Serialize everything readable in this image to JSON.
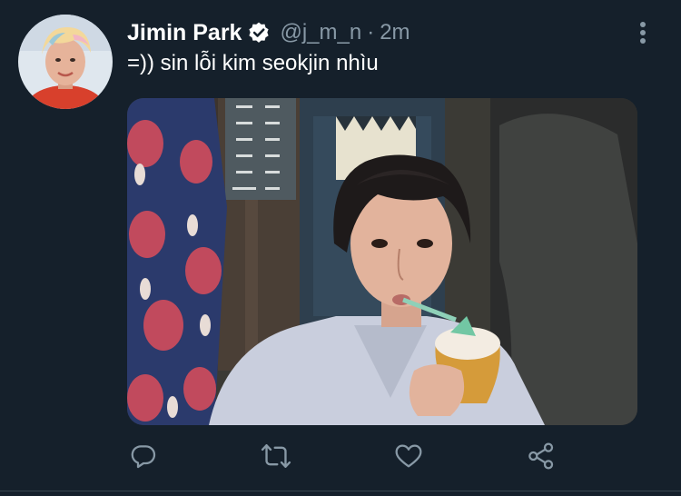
{
  "tweet": {
    "author": {
      "name": "Jimin Park",
      "handle": "@j_m_n",
      "verified": true
    },
    "separator": "·",
    "time": "2m",
    "text": "=)) sin lỗi kim seokjin nhìu"
  },
  "media": {
    "type": "photo"
  },
  "actions": [
    "reply",
    "retweet",
    "like",
    "share"
  ],
  "icons": {
    "verified": "verified-badge-icon",
    "more": "more-options-icon",
    "reply": "reply-icon",
    "retweet": "retweet-icon",
    "like": "like-icon",
    "share": "share-icon"
  },
  "colors": {
    "background": "#15202b",
    "text": "#ffffff",
    "muted": "#8899a6"
  }
}
